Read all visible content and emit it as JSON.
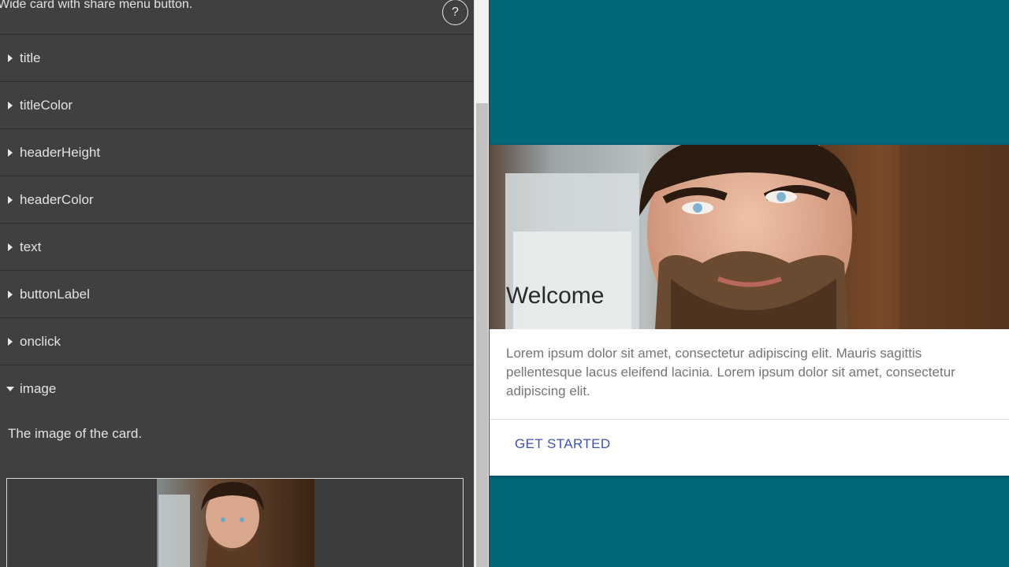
{
  "panel": {
    "description": "Wide card with share menu button.",
    "help_label": "?",
    "properties": [
      {
        "label": "title",
        "expanded": false
      },
      {
        "label": "titleColor",
        "expanded": false
      },
      {
        "label": "headerHeight",
        "expanded": false
      },
      {
        "label": "headerColor",
        "expanded": false
      },
      {
        "label": "text",
        "expanded": false
      },
      {
        "label": "buttonLabel",
        "expanded": false
      },
      {
        "label": "onclick",
        "expanded": false
      },
      {
        "label": "image",
        "expanded": true
      }
    ],
    "image_description": "The image of the card."
  },
  "card": {
    "title": "Welcome",
    "text": "Lorem ipsum dolor sit amet, consectetur adipiscing elit. Mauris sagittis pellentesque lacus eleifend lacinia. Lorem ipsum dolor sit amet, consectetur adipiscing elit.",
    "button_label": "GET STARTED"
  },
  "colors": {
    "panel_bg": "#404040",
    "preview_bg": "#006877",
    "button_accent": "#3f51b5"
  }
}
